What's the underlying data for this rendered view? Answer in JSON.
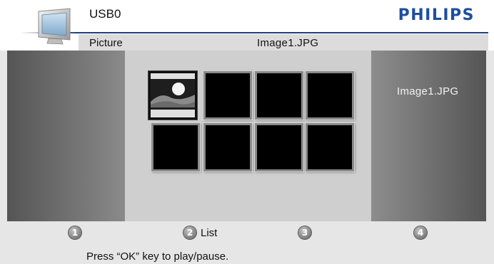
{
  "header": {
    "source": "USB0",
    "media_type": "Picture",
    "current_file": "Image1.JPG",
    "brand": "PHILIPS",
    "brand_color": "#1d4e9e",
    "tv_icon": "tv-icon"
  },
  "grid": {
    "rows": 2,
    "columns": 4,
    "selected_index": 0,
    "items": [
      {
        "icon": "landscape-thumbnail-icon"
      },
      {
        "icon": "empty-thumbnail"
      },
      {
        "icon": "empty-thumbnail"
      },
      {
        "icon": "empty-thumbnail"
      },
      {
        "icon": "empty-thumbnail"
      },
      {
        "icon": "empty-thumbnail"
      },
      {
        "icon": "empty-thumbnail"
      },
      {
        "icon": "empty-thumbnail"
      }
    ]
  },
  "info_panel": {
    "file_name": "Image1.JPG"
  },
  "footer": {
    "buttons": [
      {
        "number": "1",
        "label": ""
      },
      {
        "number": "2",
        "label": "List"
      },
      {
        "number": "3",
        "label": ""
      },
      {
        "number": "4",
        "label": ""
      }
    ],
    "hint": "Press “OK” key to play/pause."
  }
}
